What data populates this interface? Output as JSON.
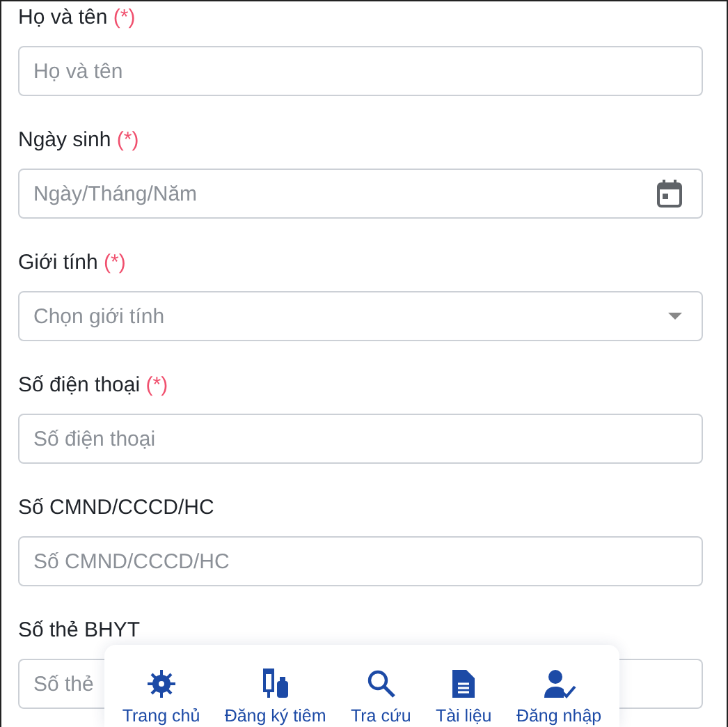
{
  "form": {
    "fields": [
      {
        "kind": "text",
        "label": "Họ và tên",
        "required_mark": "(*)",
        "placeholder": "Họ và tên"
      },
      {
        "kind": "date",
        "label": "Ngày sinh",
        "required_mark": "(*)",
        "placeholder": "Ngày/Tháng/Năm"
      },
      {
        "kind": "select",
        "label": "Giới tính",
        "required_mark": "(*)",
        "placeholder": "Chọn giới tính"
      },
      {
        "kind": "text",
        "label": "Số điện thoại",
        "required_mark": "(*)",
        "placeholder": "Số điện thoại"
      },
      {
        "kind": "text",
        "label": "Số CMND/CCCD/HC",
        "placeholder": "Số CMND/CCCD/HC"
      },
      {
        "kind": "text",
        "label": "Số thẻ BHYT",
        "placeholder": "Số thẻ"
      }
    ]
  },
  "bottom_nav": {
    "items": [
      {
        "label": "Trang chủ"
      },
      {
        "label": "Đăng ký tiêm"
      },
      {
        "label": "Tra cứu"
      },
      {
        "label": "Tài liệu"
      },
      {
        "label": "Đăng nhập"
      }
    ]
  }
}
